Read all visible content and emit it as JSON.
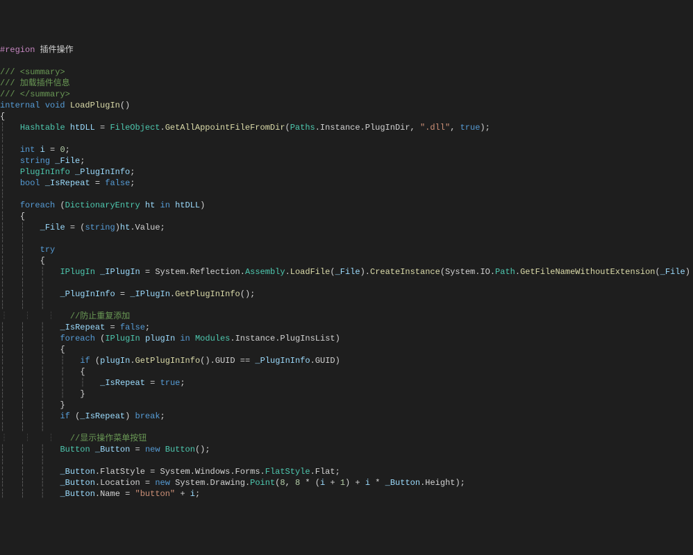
{
  "code": {
    "indent_guide": "┆",
    "lines": [
      {
        "segs": [
          {
            "t": "#region",
            "c": "region"
          },
          {
            "t": " 插件操作",
            "c": "k-white"
          }
        ]
      },
      {
        "segs": []
      },
      {
        "segs": [
          {
            "t": "/// <summary>",
            "c": "k-green"
          }
        ]
      },
      {
        "segs": [
          {
            "t": "/// 加载插件信息",
            "c": "k-green"
          }
        ]
      },
      {
        "segs": [
          {
            "t": "/// </summary>",
            "c": "k-green"
          }
        ]
      },
      {
        "segs": [
          {
            "t": "internal",
            "c": "k-blue"
          },
          {
            "t": " ",
            "c": "k-white"
          },
          {
            "t": "void",
            "c": "k-blue"
          },
          {
            "t": " ",
            "c": "k-white"
          },
          {
            "t": "LoadPlugIn",
            "c": "k-classlight"
          },
          {
            "t": "()",
            "c": "k-white"
          }
        ]
      },
      {
        "segs": [
          {
            "t": "{",
            "c": "k-white"
          }
        ]
      },
      {
        "indent": 1,
        "segs": [
          {
            "t": "Hashtable",
            "c": "k-teal"
          },
          {
            "t": " ",
            "c": "k-white"
          },
          {
            "t": "htDLL",
            "c": "k-var"
          },
          {
            "t": " = ",
            "c": "k-white"
          },
          {
            "t": "FileObject",
            "c": "k-teal"
          },
          {
            "t": ".",
            "c": "k-white"
          },
          {
            "t": "GetAllAppointFileFromDir",
            "c": "k-classlight"
          },
          {
            "t": "(",
            "c": "k-white"
          },
          {
            "t": "Paths",
            "c": "k-teal"
          },
          {
            "t": ".Instance.PlugInDir, ",
            "c": "k-white"
          },
          {
            "t": "\".dll\"",
            "c": "k-str"
          },
          {
            "t": ", ",
            "c": "k-white"
          },
          {
            "t": "true",
            "c": "k-blue"
          },
          {
            "t": ");",
            "c": "k-white"
          }
        ]
      },
      {
        "indent": 1,
        "segs": []
      },
      {
        "indent": 1,
        "segs": [
          {
            "t": "int",
            "c": "k-blue"
          },
          {
            "t": " ",
            "c": "k-white"
          },
          {
            "t": "i",
            "c": "k-var"
          },
          {
            "t": " = ",
            "c": "k-white"
          },
          {
            "t": "0",
            "c": "k-num"
          },
          {
            "t": ";",
            "c": "k-white"
          }
        ]
      },
      {
        "indent": 1,
        "segs": [
          {
            "t": "string",
            "c": "k-blue"
          },
          {
            "t": " ",
            "c": "k-white"
          },
          {
            "t": "_File",
            "c": "k-var"
          },
          {
            "t": ";",
            "c": "k-white"
          }
        ]
      },
      {
        "indent": 1,
        "segs": [
          {
            "t": "PlugInInfo",
            "c": "k-teal"
          },
          {
            "t": " ",
            "c": "k-white"
          },
          {
            "t": "_PlugInInfo",
            "c": "k-var"
          },
          {
            "t": ";",
            "c": "k-white"
          }
        ]
      },
      {
        "indent": 1,
        "segs": [
          {
            "t": "bool",
            "c": "k-blue"
          },
          {
            "t": " ",
            "c": "k-white"
          },
          {
            "t": "_IsRepeat",
            "c": "k-var"
          },
          {
            "t": " = ",
            "c": "k-white"
          },
          {
            "t": "false",
            "c": "k-blue"
          },
          {
            "t": ";",
            "c": "k-white"
          }
        ]
      },
      {
        "indent": 1,
        "segs": []
      },
      {
        "indent": 1,
        "segs": [
          {
            "t": "foreach",
            "c": "k-blue"
          },
          {
            "t": " (",
            "c": "k-white"
          },
          {
            "t": "DictionaryEntry",
            "c": "k-teal"
          },
          {
            "t": " ",
            "c": "k-white"
          },
          {
            "t": "ht",
            "c": "k-var"
          },
          {
            "t": " ",
            "c": "k-white"
          },
          {
            "t": "in",
            "c": "k-blue"
          },
          {
            "t": " ",
            "c": "k-white"
          },
          {
            "t": "htDLL",
            "c": "k-var"
          },
          {
            "t": ")",
            "c": "k-white"
          }
        ]
      },
      {
        "indent": 1,
        "segs": [
          {
            "t": "{",
            "c": "k-white"
          }
        ]
      },
      {
        "indent": 2,
        "segs": [
          {
            "t": "_File",
            "c": "k-var"
          },
          {
            "t": " = (",
            "c": "k-white"
          },
          {
            "t": "string",
            "c": "k-blue"
          },
          {
            "t": ")",
            "c": "k-white"
          },
          {
            "t": "ht",
            "c": "k-var"
          },
          {
            "t": ".Value;",
            "c": "k-white"
          }
        ]
      },
      {
        "indent": 2,
        "segs": []
      },
      {
        "indent": 2,
        "segs": [
          {
            "t": "try",
            "c": "k-blue"
          }
        ]
      },
      {
        "indent": 2,
        "segs": [
          {
            "t": "{",
            "c": "k-white"
          }
        ]
      },
      {
        "indent": 3,
        "segs": [
          {
            "t": "IPlugIn",
            "c": "k-teal"
          },
          {
            "t": " ",
            "c": "k-white"
          },
          {
            "t": "_IPlugIn",
            "c": "k-var"
          },
          {
            "t": " = System.Reflection.",
            "c": "k-white"
          },
          {
            "t": "Assembly",
            "c": "k-teal"
          },
          {
            "t": ".",
            "c": "k-white"
          },
          {
            "t": "LoadFile",
            "c": "k-classlight"
          },
          {
            "t": "(",
            "c": "k-white"
          },
          {
            "t": "_File",
            "c": "k-var"
          },
          {
            "t": ").",
            "c": "k-white"
          },
          {
            "t": "CreateInstance",
            "c": "k-classlight"
          },
          {
            "t": "(System.IO.",
            "c": "k-white"
          },
          {
            "t": "Path",
            "c": "k-teal"
          },
          {
            "t": ".",
            "c": "k-white"
          },
          {
            "t": "GetFileNameWithoutExtension",
            "c": "k-classlight"
          },
          {
            "t": "(",
            "c": "k-white"
          },
          {
            "t": "_File",
            "c": "k-var"
          },
          {
            "t": ")",
            "c": "k-white"
          }
        ]
      },
      {
        "indent": 3,
        "segs": []
      },
      {
        "indent": 3,
        "segs": [
          {
            "t": "_PlugInInfo",
            "c": "k-var"
          },
          {
            "t": " = ",
            "c": "k-white"
          },
          {
            "t": "_IPlugIn",
            "c": "k-var"
          },
          {
            "t": ".",
            "c": "k-white"
          },
          {
            "t": "GetPlugInInfo",
            "c": "k-classlight"
          },
          {
            "t": "();",
            "c": "k-white"
          }
        ]
      },
      {
        "indent": 3,
        "segs": []
      },
      {
        "indent": 3,
        "segs": [
          {
            "t": "//防止重复添加",
            "c": "k-green"
          }
        ]
      },
      {
        "indent": 3,
        "segs": [
          {
            "t": "_IsRepeat",
            "c": "k-var"
          },
          {
            "t": " = ",
            "c": "k-white"
          },
          {
            "t": "false",
            "c": "k-blue"
          },
          {
            "t": ";",
            "c": "k-white"
          }
        ]
      },
      {
        "indent": 3,
        "segs": [
          {
            "t": "foreach",
            "c": "k-blue"
          },
          {
            "t": " (",
            "c": "k-white"
          },
          {
            "t": "IPlugIn",
            "c": "k-teal"
          },
          {
            "t": " ",
            "c": "k-white"
          },
          {
            "t": "plugIn",
            "c": "k-var"
          },
          {
            "t": " ",
            "c": "k-white"
          },
          {
            "t": "in",
            "c": "k-blue"
          },
          {
            "t": " ",
            "c": "k-white"
          },
          {
            "t": "Modules",
            "c": "k-teal"
          },
          {
            "t": ".Instance.PlugInsList)",
            "c": "k-white"
          }
        ]
      },
      {
        "indent": 3,
        "segs": [
          {
            "t": "{",
            "c": "k-white"
          }
        ]
      },
      {
        "indent": 4,
        "segs": [
          {
            "t": "if",
            "c": "k-blue"
          },
          {
            "t": " (",
            "c": "k-white"
          },
          {
            "t": "plugIn",
            "c": "k-var"
          },
          {
            "t": ".",
            "c": "k-white"
          },
          {
            "t": "GetPlugInInfo",
            "c": "k-classlight"
          },
          {
            "t": "().GUID == ",
            "c": "k-white"
          },
          {
            "t": "_PlugInInfo",
            "c": "k-var"
          },
          {
            "t": ".GUID)",
            "c": "k-white"
          }
        ]
      },
      {
        "indent": 4,
        "segs": [
          {
            "t": "{",
            "c": "k-white"
          }
        ]
      },
      {
        "indent": 5,
        "segs": [
          {
            "t": "_IsRepeat",
            "c": "k-var"
          },
          {
            "t": " = ",
            "c": "k-white"
          },
          {
            "t": "true",
            "c": "k-blue"
          },
          {
            "t": ";",
            "c": "k-white"
          }
        ]
      },
      {
        "indent": 4,
        "segs": [
          {
            "t": "}",
            "c": "k-white"
          }
        ]
      },
      {
        "indent": 3,
        "segs": [
          {
            "t": "}",
            "c": "k-white"
          }
        ]
      },
      {
        "indent": 3,
        "segs": [
          {
            "t": "if",
            "c": "k-blue"
          },
          {
            "t": " (",
            "c": "k-white"
          },
          {
            "t": "_IsRepeat",
            "c": "k-var"
          },
          {
            "t": ") ",
            "c": "k-white"
          },
          {
            "t": "break",
            "c": "k-blue"
          },
          {
            "t": ";",
            "c": "k-white"
          }
        ]
      },
      {
        "indent": 3,
        "segs": []
      },
      {
        "indent": 3,
        "segs": [
          {
            "t": "//显示操作菜单按钮",
            "c": "k-green"
          }
        ]
      },
      {
        "indent": 3,
        "segs": [
          {
            "t": "Button",
            "c": "k-teal"
          },
          {
            "t": " ",
            "c": "k-white"
          },
          {
            "t": "_Button",
            "c": "k-var"
          },
          {
            "t": " = ",
            "c": "k-white"
          },
          {
            "t": "new",
            "c": "k-blue"
          },
          {
            "t": " ",
            "c": "k-white"
          },
          {
            "t": "Button",
            "c": "k-teal"
          },
          {
            "t": "();",
            "c": "k-white"
          }
        ]
      },
      {
        "indent": 3,
        "segs": []
      },
      {
        "indent": 3,
        "segs": [
          {
            "t": "_Button",
            "c": "k-var"
          },
          {
            "t": ".FlatStyle = System.Windows.Forms.",
            "c": "k-white"
          },
          {
            "t": "FlatStyle",
            "c": "k-teal"
          },
          {
            "t": ".Flat;",
            "c": "k-white"
          }
        ]
      },
      {
        "indent": 3,
        "segs": [
          {
            "t": "_Button",
            "c": "k-var"
          },
          {
            "t": ".Location = ",
            "c": "k-white"
          },
          {
            "t": "new",
            "c": "k-blue"
          },
          {
            "t": " System.Drawing.",
            "c": "k-white"
          },
          {
            "t": "Point",
            "c": "k-teal"
          },
          {
            "t": "(",
            "c": "k-white"
          },
          {
            "t": "8",
            "c": "k-num"
          },
          {
            "t": ", ",
            "c": "k-white"
          },
          {
            "t": "8",
            "c": "k-num"
          },
          {
            "t": " * (",
            "c": "k-white"
          },
          {
            "t": "i",
            "c": "k-var"
          },
          {
            "t": " + ",
            "c": "k-white"
          },
          {
            "t": "1",
            "c": "k-num"
          },
          {
            "t": ") + ",
            "c": "k-white"
          },
          {
            "t": "i",
            "c": "k-var"
          },
          {
            "t": " * ",
            "c": "k-white"
          },
          {
            "t": "_Button",
            "c": "k-var"
          },
          {
            "t": ".Height);",
            "c": "k-white"
          }
        ]
      },
      {
        "indent": 3,
        "segs": [
          {
            "t": "_Button",
            "c": "k-var"
          },
          {
            "t": ".Name = ",
            "c": "k-white"
          },
          {
            "t": "\"button\"",
            "c": "k-str"
          },
          {
            "t": " + ",
            "c": "k-white"
          },
          {
            "t": "i",
            "c": "k-var"
          },
          {
            "t": ";",
            "c": "k-white"
          }
        ]
      }
    ]
  }
}
